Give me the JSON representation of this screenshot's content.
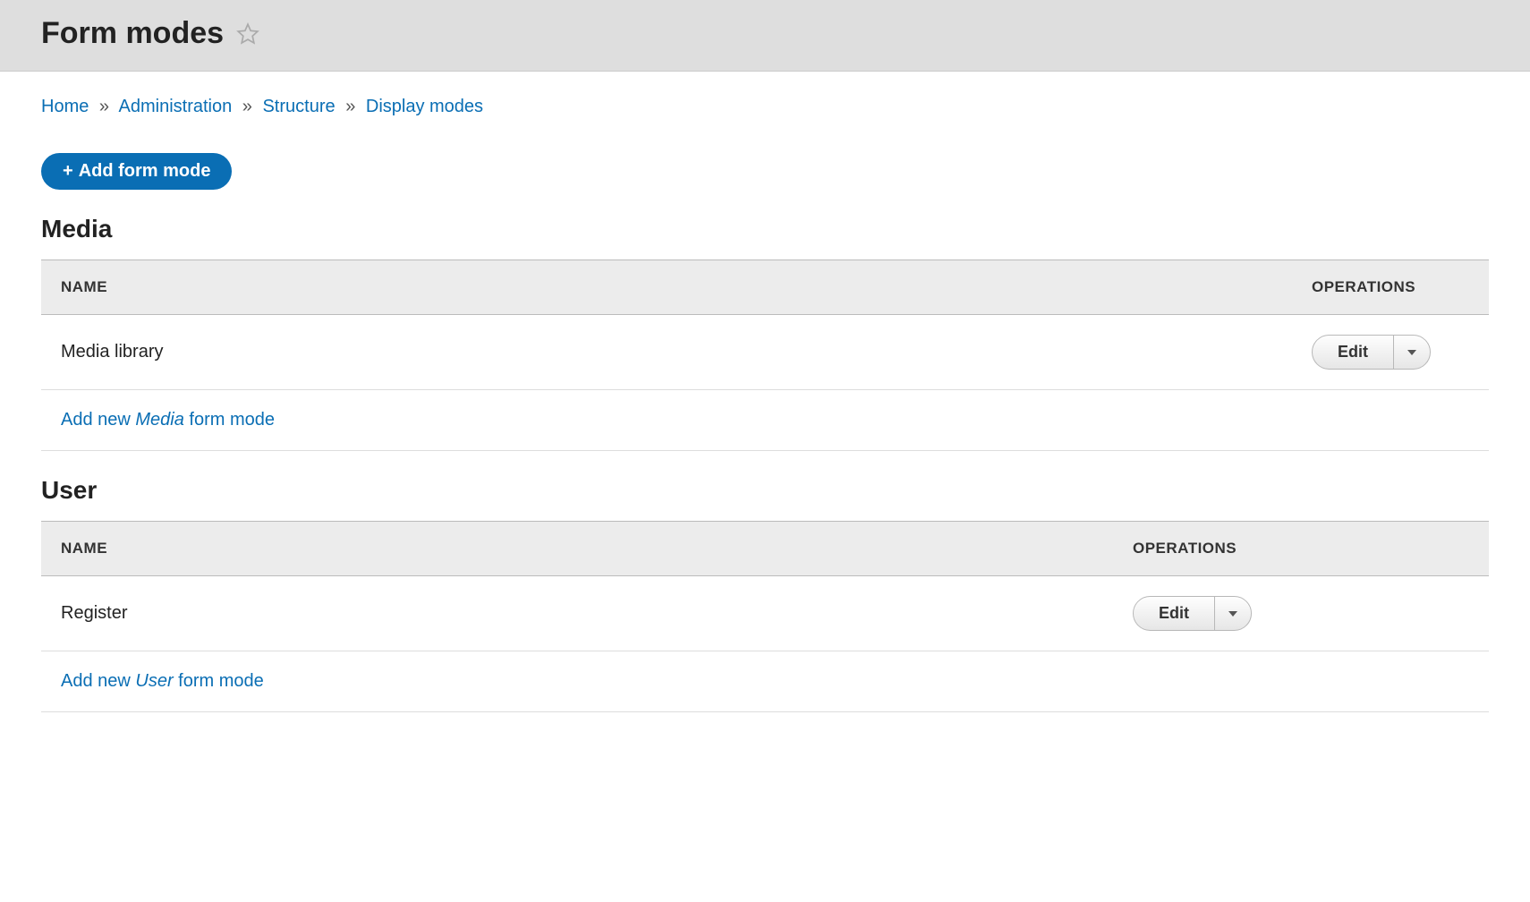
{
  "header": {
    "title": "Form modes"
  },
  "breadcrumb": {
    "items": [
      "Home",
      "Administration",
      "Structure",
      "Display modes"
    ],
    "sep": "»"
  },
  "actions": {
    "add_label": "Add form mode"
  },
  "table": {
    "col_name": "NAME",
    "col_ops": "OPERATIONS",
    "edit_label": "Edit"
  },
  "sections": [
    {
      "title": "Media",
      "rows": [
        {
          "name": "Media library"
        }
      ],
      "add_prefix": "Add new ",
      "add_entity": "Media",
      "add_suffix": " form mode"
    },
    {
      "title": "User",
      "rows": [
        {
          "name": "Register"
        }
      ],
      "add_prefix": "Add new ",
      "add_entity": "User",
      "add_suffix": " form mode"
    }
  ]
}
